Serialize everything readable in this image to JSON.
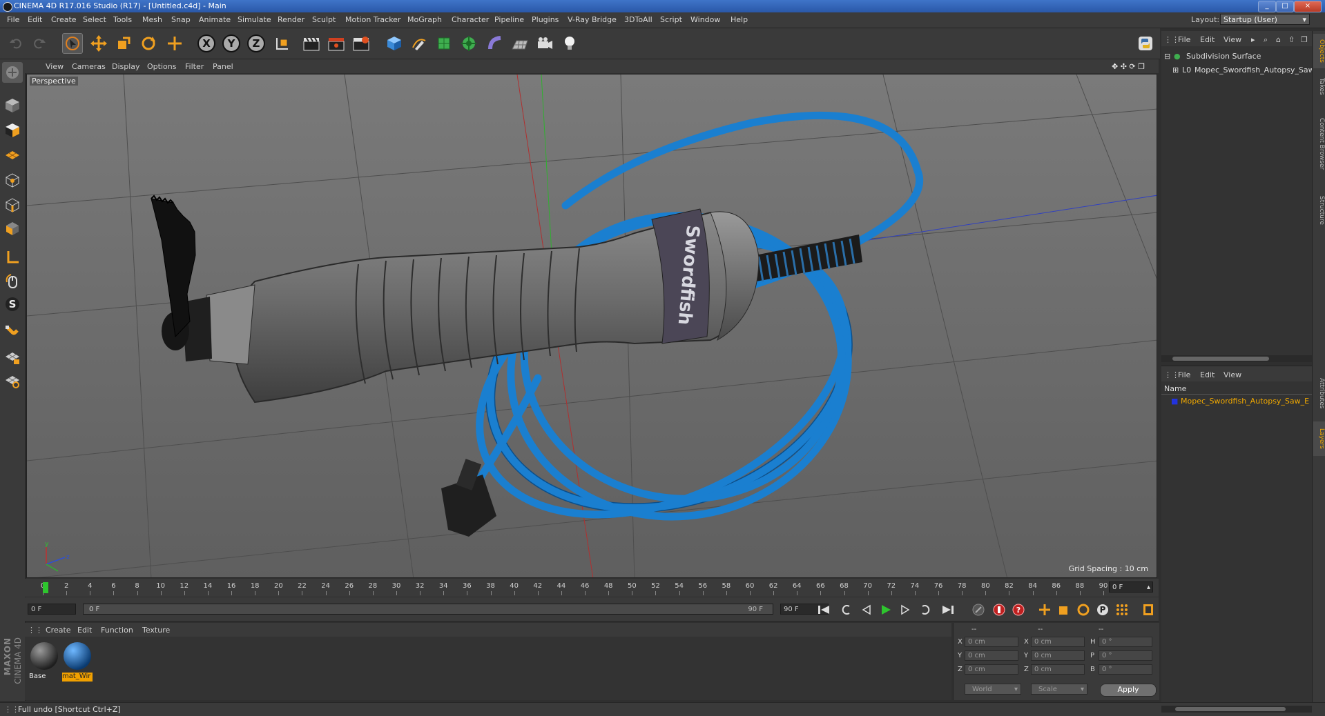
{
  "window": {
    "title": "CINEMA 4D R17.016 Studio (R17) - [Untitled.c4d] - Main",
    "min": "_",
    "max": "□",
    "close": "×"
  },
  "menu": [
    "File",
    "Edit",
    "Create",
    "Select",
    "Tools",
    "Mesh",
    "Snap",
    "Animate",
    "Simulate",
    "Render",
    "Sculpt",
    "Motion Tracker",
    "MoGraph",
    "Character",
    "Pipeline",
    "Plugins",
    "V-Ray Bridge",
    "3DToAll",
    "Script",
    "Window",
    "Help"
  ],
  "layout": {
    "label": "Layout:",
    "value": "Startup (User)"
  },
  "toolbar": {
    "axis_x": "X",
    "axis_y": "Y",
    "axis_z": "Z"
  },
  "viewport": {
    "menu": [
      "View",
      "Cameras",
      "Display",
      "Options",
      "Filter",
      "Panel"
    ],
    "label": "Perspective",
    "grid_spacing": "Grid Spacing : 10 cm",
    "brand_text": "Swordfish"
  },
  "timeline": {
    "ticks": [
      "0",
      "2",
      "4",
      "6",
      "8",
      "10",
      "12",
      "14",
      "16",
      "18",
      "20",
      "22",
      "24",
      "26",
      "28",
      "30",
      "32",
      "34",
      "36",
      "38",
      "40",
      "42",
      "44",
      "46",
      "48",
      "50",
      "52",
      "54",
      "56",
      "58",
      "60",
      "62",
      "64",
      "66",
      "68",
      "70",
      "72",
      "74",
      "76",
      "78",
      "80",
      "82",
      "84",
      "86",
      "88",
      "90"
    ],
    "current_frame": "0 F"
  },
  "playback": {
    "start": "0 F",
    "range_start": "0 F",
    "range_end": "90 F",
    "end": "90 F"
  },
  "materials": {
    "menu": [
      "Create",
      "Edit",
      "Function",
      "Texture"
    ],
    "items": [
      {
        "name": "Base",
        "color": "#4a4a4a"
      },
      {
        "name": "mat_Wir",
        "color": "#1e6fc0"
      }
    ]
  },
  "coords": {
    "header1": "--",
    "header2": "--",
    "header3": "--",
    "rows": [
      {
        "a": "X",
        "av": "0 cm",
        "b": "X",
        "bv": "0 cm",
        "c": "H",
        "cv": "0 °"
      },
      {
        "a": "Y",
        "av": "0 cm",
        "b": "Y",
        "bv": "0 cm",
        "c": "P",
        "cv": "0 °"
      },
      {
        "a": "Z",
        "av": "0 cm",
        "b": "Z",
        "bv": "0 cm",
        "c": "B",
        "cv": "0 °"
      }
    ],
    "world": "World",
    "scale": "Scale",
    "apply": "Apply"
  },
  "objects": {
    "menu": [
      "File",
      "Edit",
      "View"
    ],
    "items": [
      "Subdivision Surface",
      "Mopec_Swordfish_Autopsy_Saw_"
    ]
  },
  "layers": {
    "menu": [
      "File",
      "Edit",
      "View"
    ],
    "column": "Name",
    "items": [
      "Mopec_Swordfish_Autopsy_Saw_E"
    ]
  },
  "side_tabs": [
    "Objects",
    "Takes",
    "Content Browser",
    "Structure",
    "Attributes",
    "Layers"
  ],
  "status": "Full undo [Shortcut Ctrl+Z]",
  "logo": {
    "maxon": "MAXON",
    "product": "CINEMA 4D"
  }
}
